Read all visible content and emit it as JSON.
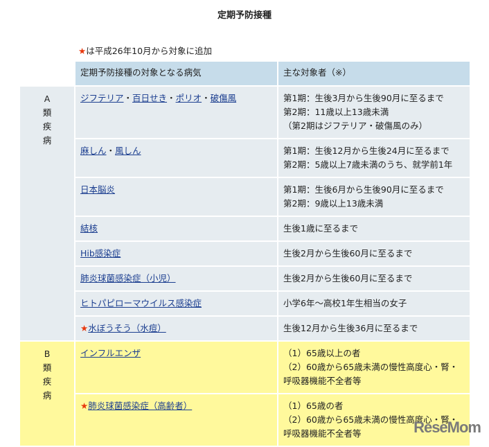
{
  "title": "定期予防接種",
  "note": "は平成26年10月から対象に追加",
  "headers": [
    "定期予防接種の対象となる病気",
    "主な対象者（※）"
  ],
  "groups": [
    {
      "label": [
        "A",
        "類",
        "疾",
        "病"
      ],
      "rows": [
        {
          "disease": [
            "ジフテリア",
            "百日せき",
            "ポリオ",
            "破傷風"
          ],
          "target": [
            "第1期：生後3月から生後90月に至るまで",
            "第2期：11歳以上13歳未満",
            "（第2期はジフテリア・破傷風のみ）"
          ]
        },
        {
          "disease": [
            "麻しん",
            "風しん"
          ],
          "target": [
            "第1期：生後12月から生後24月に至るまで",
            "第2期：5歳以上7歳未満のうち、就学前1年"
          ]
        },
        {
          "disease": "日本脳炎",
          "target": [
            "第1期：生後6月から生後90月に至るまで",
            "第2期：9歳以上13歳未満"
          ]
        },
        {
          "disease": "結核",
          "target": "生後1歳に至るまで"
        },
        {
          "disease": "Hib感染症",
          "target": "生後2月から生後60月に至るまで"
        },
        {
          "disease": "肺炎球菌感染症（小児）",
          "target": "生後2月から生後60月に至るまで"
        },
        {
          "disease": "ヒトパピローマウイルス感染症",
          "target": "小学6年～高校1年生相当の女子"
        },
        {
          "disease": "水ぼうそう（水痘）",
          "new": true,
          "target": "生後12月から生後36月に至るまで"
        }
      ]
    },
    {
      "label": [
        "B",
        "類",
        "疾",
        "病"
      ],
      "rows": [
        {
          "disease": "インフルエンザ",
          "target": [
            "（1）65歳以上の者",
            "（2）60歳から65歳未満の慢性高度心・腎・呼吸器機能不全者等"
          ]
        },
        {
          "disease": "肺炎球菌感染症（高齢者）",
          "new": true,
          "target": [
            "（1）65歳の者",
            "（2）60歳から65歳未満の慢性高度心・腎・呼吸器機能不全者等"
          ]
        }
      ]
    }
  ],
  "star_symbol": "★",
  "watermark": "ReseMom"
}
